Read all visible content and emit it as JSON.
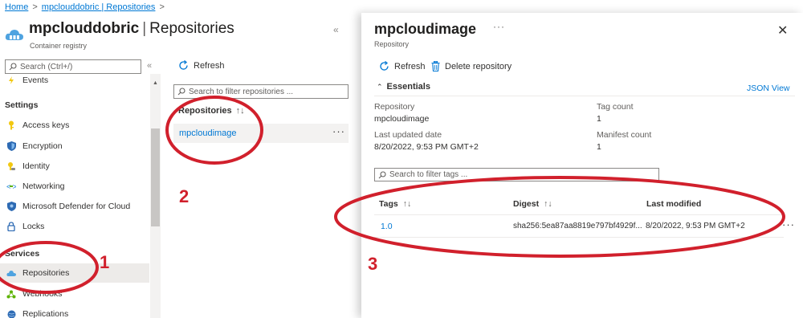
{
  "breadcrumb": {
    "home": "Home",
    "sep": ">",
    "current": "mpclouddobric | Repositories",
    "trailing_sep": ">"
  },
  "registry": {
    "name": "mpclouddobric",
    "section": "Repositories",
    "type": "Container registry"
  },
  "sidebar": {
    "search_placeholder": "Search (Ctrl+/)",
    "items": [
      {
        "label": "Events",
        "icon": "events-icon"
      },
      {
        "heading": "Settings"
      },
      {
        "label": "Access keys",
        "icon": "key-icon"
      },
      {
        "label": "Encryption",
        "icon": "shield-icon"
      },
      {
        "label": "Identity",
        "icon": "identity-icon"
      },
      {
        "label": "Networking",
        "icon": "networking-icon"
      },
      {
        "label": "Microsoft Defender for Cloud",
        "icon": "defender-icon"
      },
      {
        "label": "Locks",
        "icon": "lock-icon"
      },
      {
        "heading": "Services"
      },
      {
        "label": "Repositories",
        "icon": "cloud-icon",
        "active": true
      },
      {
        "label": "Webhooks",
        "icon": "webhook-icon"
      },
      {
        "label": "Replications",
        "icon": "globe-icon"
      }
    ]
  },
  "repositories": {
    "refresh_label": "Refresh",
    "search_placeholder": "Search to filter repositories ...",
    "column_header": "Repositories",
    "sort_glyph": "↑↓",
    "rows": [
      {
        "name": "mpcloudimage"
      }
    ],
    "row_more": "···"
  },
  "panel": {
    "title": "mpcloudimage",
    "subtitle": "Repository",
    "more": "···",
    "close": "✕",
    "refresh_label": "Refresh",
    "delete_label": "Delete repository",
    "essentials_label": "Essentials",
    "json_view_label": "JSON View",
    "properties": {
      "repository_label": "Repository",
      "repository_value": "mpcloudimage",
      "last_updated_label": "Last updated date",
      "last_updated_value": "8/20/2022, 9:53 PM GMT+2",
      "tag_count_label": "Tag count",
      "tag_count_value": "1",
      "manifest_count_label": "Manifest count",
      "manifest_count_value": "1"
    },
    "tags_search_placeholder": "Search to filter tags ...",
    "columns": {
      "tags": "Tags",
      "digest": "Digest",
      "last_modified": "Last modified"
    },
    "rows": [
      {
        "tag": "1.0",
        "digest": "sha256:5ea87aa8819e797bf4929f...",
        "last_modified": "8/20/2022, 9:53 PM GMT+2"
      }
    ],
    "row_more": "···"
  },
  "annotations": {
    "one": "1",
    "two": "2",
    "three": "3"
  },
  "colors": {
    "accent": "#0078d4",
    "annotation": "#d1202c"
  }
}
